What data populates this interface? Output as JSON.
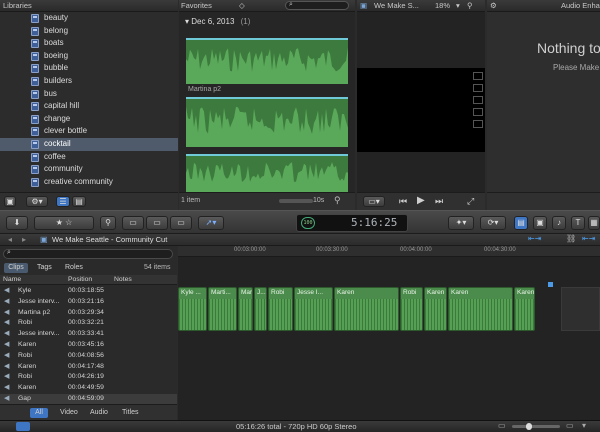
{
  "libraries": {
    "header": "Libraries",
    "items": [
      "beauty",
      "belong",
      "boats",
      "boeing",
      "bubble",
      "builders",
      "bus",
      "capital hill",
      "change",
      "clever bottle",
      "cocktail",
      "coffee",
      "community",
      "creative community"
    ],
    "selected_index": 10
  },
  "browser": {
    "filter_label": "Favorites",
    "date_heading": "Dec 6, 2013",
    "count": "(1)",
    "clip_name": "Martina p2",
    "footer_items": "1 item",
    "duration_label": "10s"
  },
  "viewer": {
    "title": "We Make S...",
    "zoom": "18%"
  },
  "inspector": {
    "title": "Audio Enha",
    "nothing_title": "Nothing to",
    "nothing_sub": "Please Make"
  },
  "toolbar": {
    "timecode": "5:16:25",
    "timecode_badge": "100"
  },
  "project": {
    "title": "We Make Seattle - Community Cut"
  },
  "index": {
    "tabs": [
      "Clips",
      "Tags",
      "Roles"
    ],
    "item_count": "54 items",
    "columns": [
      "Name",
      "Position",
      "Notes"
    ],
    "rows": [
      {
        "name": "Kyle",
        "position": "00:03:18:55"
      },
      {
        "name": "Jesse interv...",
        "position": "00:03:21:16"
      },
      {
        "name": "Martina p2",
        "position": "00:03:29:34"
      },
      {
        "name": "Robi",
        "position": "00:03:32:21"
      },
      {
        "name": "Jesse interv...",
        "position": "00:03:33:41"
      },
      {
        "name": "Karen",
        "position": "00:03:45:16"
      },
      {
        "name": "Robi",
        "position": "00:04:08:56"
      },
      {
        "name": "Karen",
        "position": "00:04:17:48"
      },
      {
        "name": "Robi",
        "position": "00:04:26:19"
      },
      {
        "name": "Karen",
        "position": "00:04:49:59"
      },
      {
        "name": "Gap",
        "position": "00:04:59:09"
      }
    ],
    "bottom_tabs": [
      "All",
      "Video",
      "Audio",
      "Titles"
    ]
  },
  "timeline": {
    "ruler": [
      "00:03:00:00",
      "00:03:30:00",
      "00:04:00:00",
      "00:04:30:00"
    ],
    "clips": [
      "Kyle ...",
      "Marti...",
      "Marti...",
      "J...",
      "Robi",
      "Jesse I...",
      "Karen",
      "Robi",
      "Karen",
      "Karen",
      "Karen"
    ]
  },
  "status": {
    "text": "05:16:26 total - 720p HD 60p Stereo"
  },
  "colors": {
    "accent": "#4c9be8",
    "clip_green": "#4b8b4b",
    "selection": "#4f5b6b"
  }
}
